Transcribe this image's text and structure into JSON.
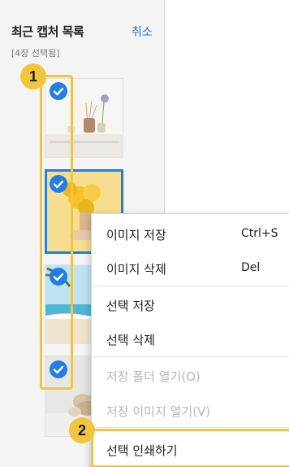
{
  "panel": {
    "title": "최근 캡처 목록",
    "cancel_label": "취소",
    "selected_count": "[4장 선택됨]"
  },
  "thumbnails": [
    {
      "name": "thumbnail-vases",
      "selected": true
    },
    {
      "name": "thumbnail-yellow-flowers",
      "selected": true
    },
    {
      "name": "thumbnail-beach",
      "selected": true
    },
    {
      "name": "thumbnail-shells",
      "selected": true
    }
  ],
  "badges": {
    "one": "1",
    "two": "2"
  },
  "menu": {
    "save_image": "이미지 저장",
    "save_image_shortcut": "Ctrl+S",
    "delete_image": "이미지 삭제",
    "delete_image_shortcut": "Del",
    "save_selection": "선택 저장",
    "delete_selection": "선택 삭제",
    "open_save_folder": "저장 폴더 열기(O)",
    "open_saved_image": "저장 이미지 열기(V)",
    "print_selection": "선택 인쇄하기"
  },
  "colors": {
    "accent": "#1f7ee8",
    "highlight": "#f2c53c",
    "link": "#2f71d6"
  }
}
